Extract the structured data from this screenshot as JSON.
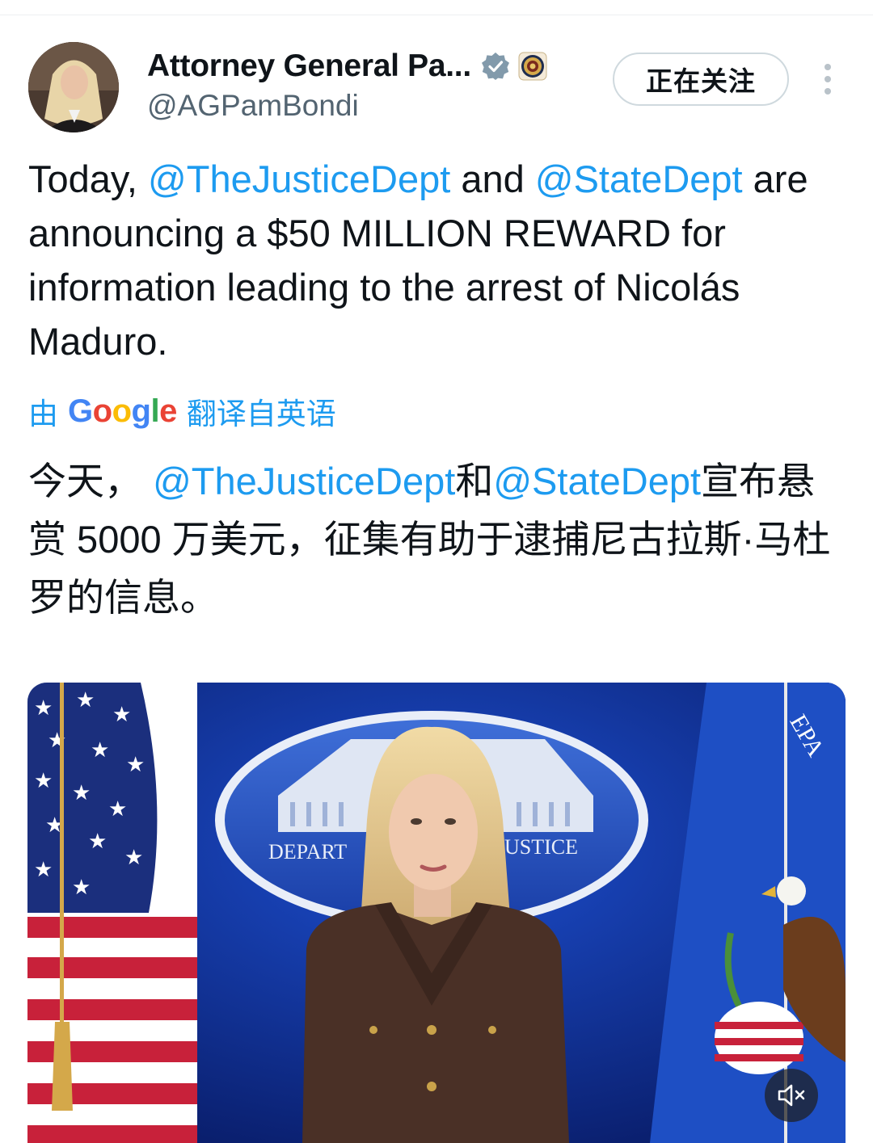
{
  "header": {
    "display_name": "Attorney General Pa...",
    "handle": "@AGPamBondi",
    "follow_label": "正在关注",
    "icons": {
      "avatar": "avatar-photo",
      "verified": "verified-badge-icon",
      "affiliation": "doj-seal-icon",
      "more": "more-vertical-icon"
    }
  },
  "tweet": {
    "seg1": "Today, ",
    "mention1": "@TheJusticeDept",
    "seg2": " and ",
    "mention2": "@StateDept",
    "seg3": " are announcing a $50 MILLION REWARD for information leading to the arrest of Nicolás Maduro."
  },
  "translation": {
    "prefix": "由",
    "google": "Google",
    "suffix": "翻译自英语",
    "seg1": "今天， ",
    "mention1": "@TheJusticeDept",
    "seg2": "和",
    "mention2": "@StateDept",
    "seg3": "宣布悬赏 5000 万美元，征集有助于逮捕尼古拉斯·马杜罗的信息。"
  },
  "media": {
    "backdrop_text_left": "DEPART",
    "backdrop_text_right": "USTICE",
    "flag_text": "EPA",
    "mute_icon": "volume-muted-icon"
  },
  "colors": {
    "accent": "#1d9bf0",
    "text": "#0f1419",
    "secondary": "#536471",
    "verified_gray": "#829aab"
  }
}
